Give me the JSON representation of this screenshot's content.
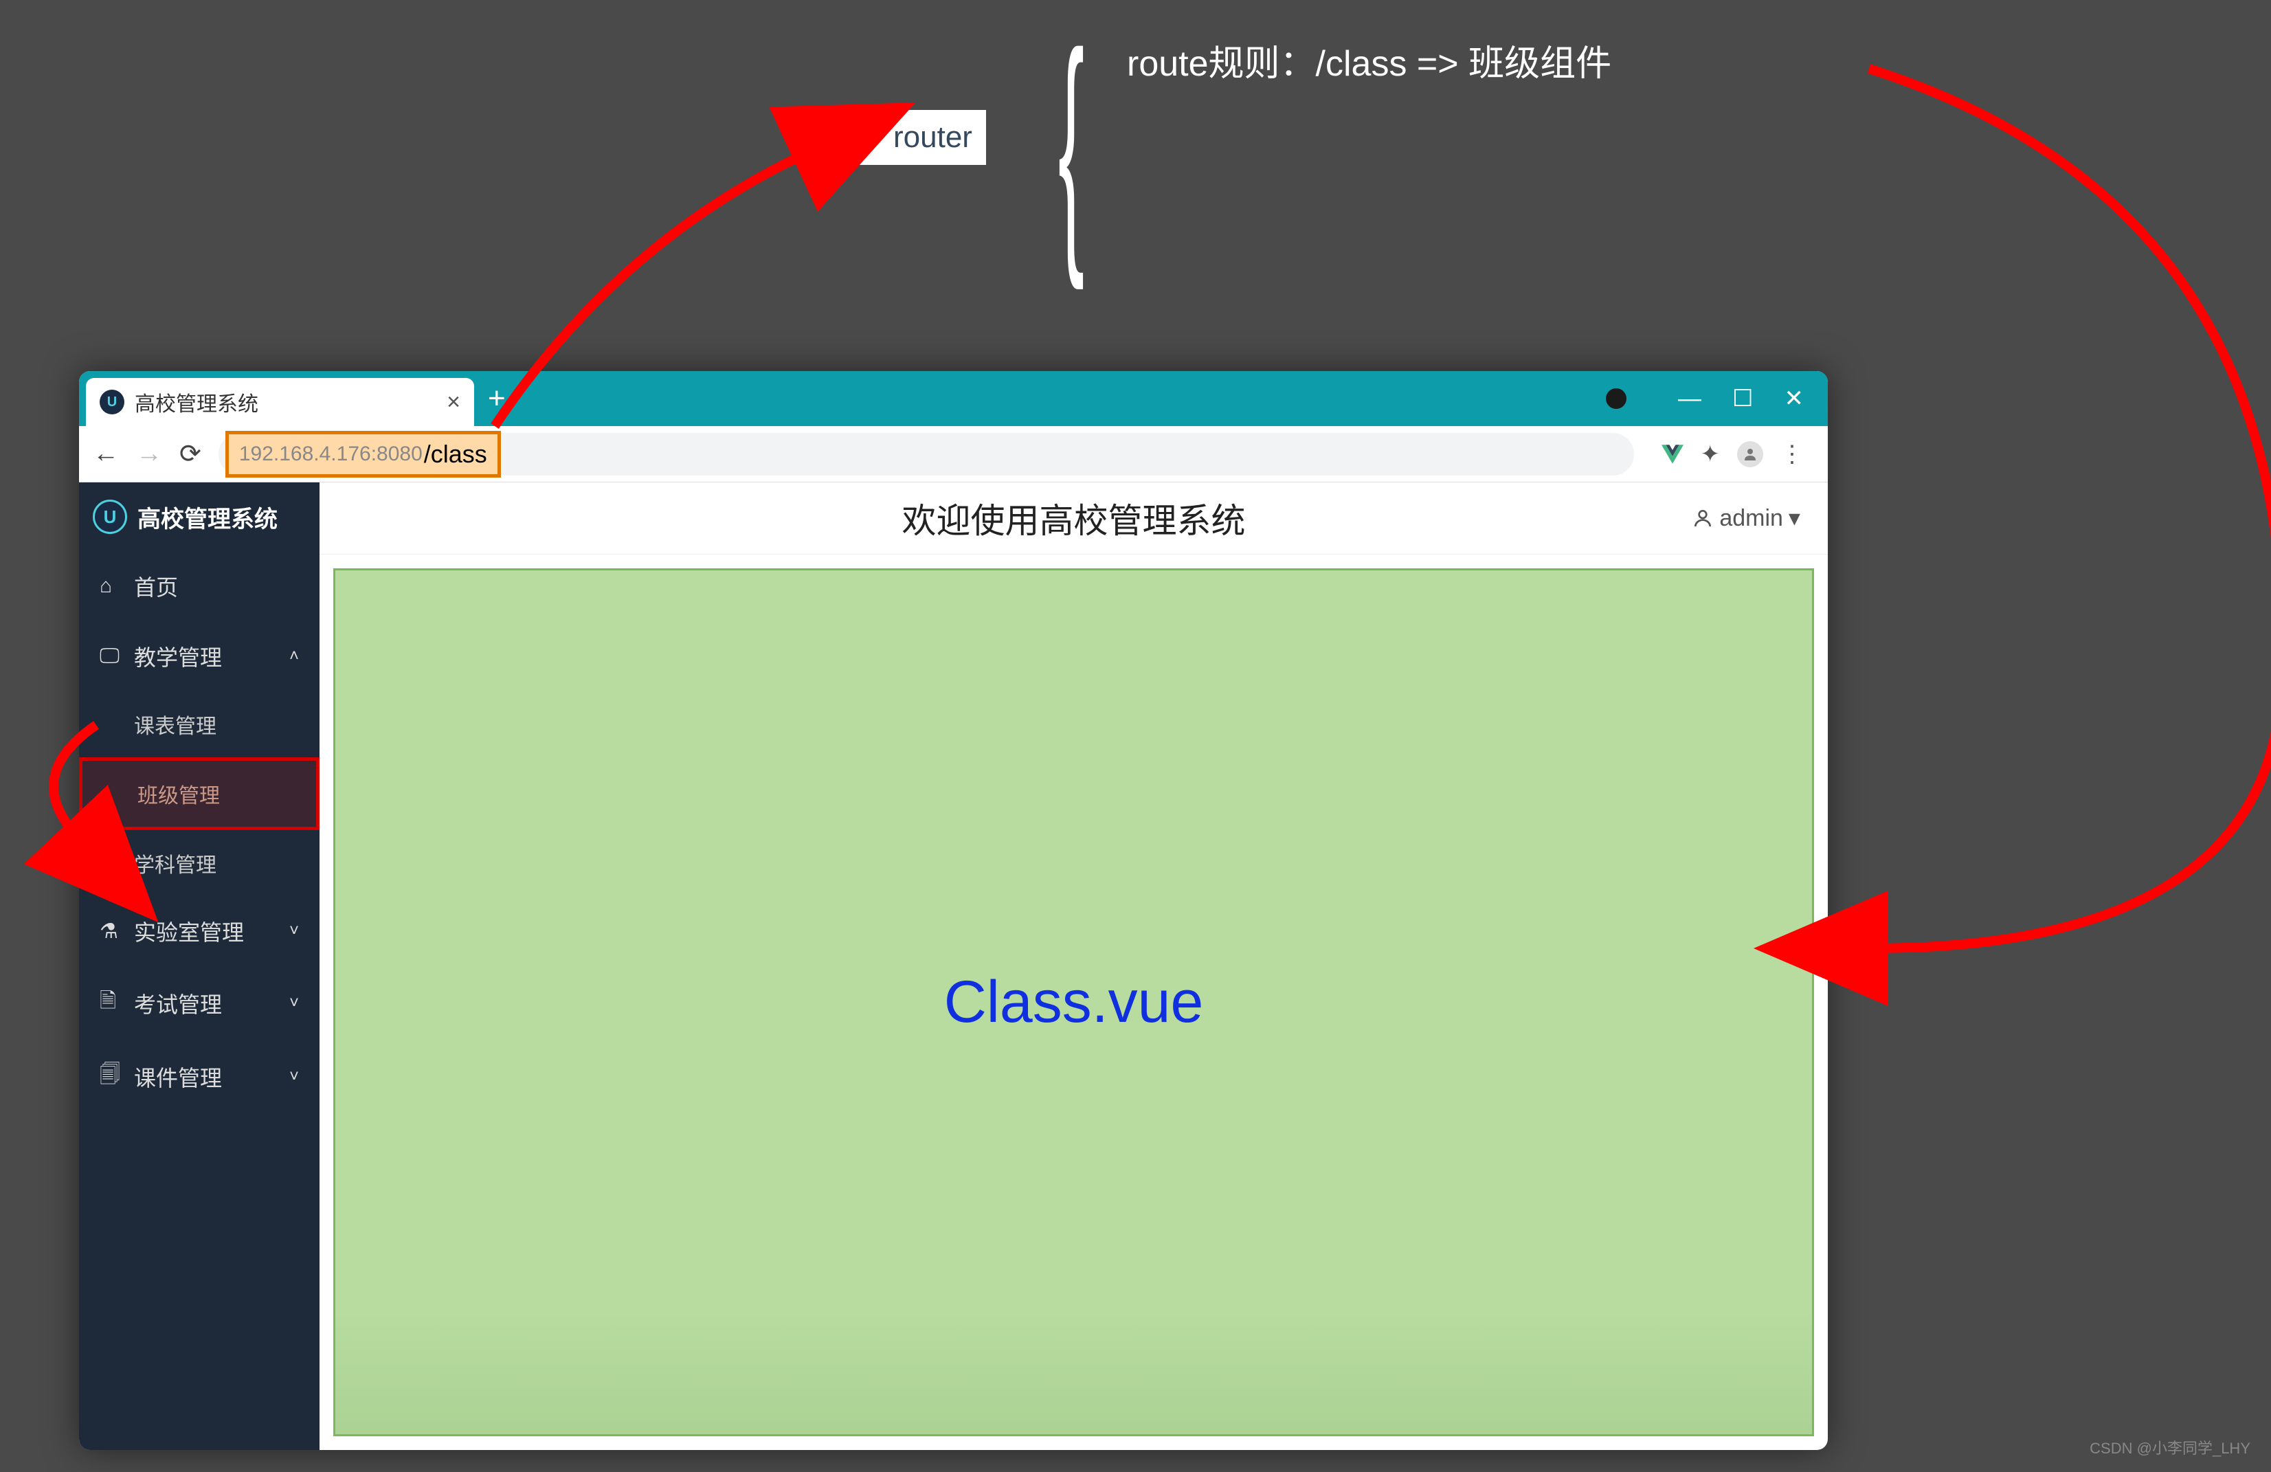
{
  "router": {
    "label": "router",
    "rule": "route规则：/class =>  班级组件"
  },
  "browser": {
    "tab_title": "高校管理系统",
    "url_ip": "192.168.4.176:8080",
    "url_path": "/class"
  },
  "app": {
    "name": "高校管理系统",
    "header_title": "欢迎使用高校管理系统",
    "user": "admin",
    "sidebar": {
      "home": "首页",
      "teaching": "教学管理",
      "schedule": "课表管理",
      "class": "班级管理",
      "subject": "学科管理",
      "lab": "实验室管理",
      "exam": "考试管理",
      "courseware": "课件管理"
    },
    "content_label": "Class.vue"
  },
  "watermark": "CSDN @小李同学_LHY"
}
